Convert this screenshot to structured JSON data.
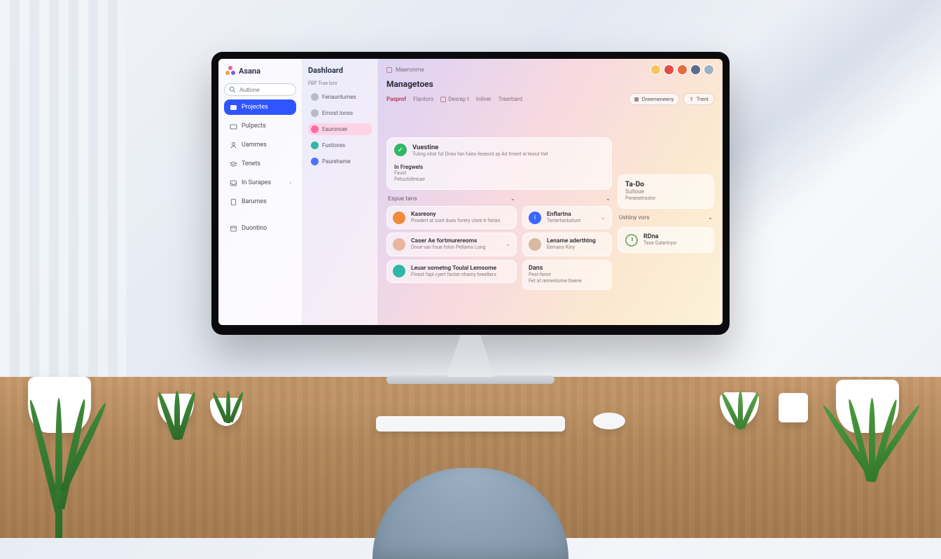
{
  "brand": {
    "name": "Asana"
  },
  "search": {
    "placeholder": "Autlone"
  },
  "sidebar": {
    "items": [
      {
        "label": "Projectes",
        "icon": "home-icon",
        "active": true
      },
      {
        "label": "Pulpects",
        "icon": "folder-icon"
      },
      {
        "label": "Uammes",
        "icon": "user-icon"
      },
      {
        "label": "Tenets",
        "icon": "layers-icon"
      },
      {
        "label": "In Surapes",
        "icon": "inbox-icon",
        "caret": true
      },
      {
        "label": "Barumes",
        "icon": "doc-icon"
      },
      {
        "label": "Duontino",
        "icon": "calendar-icon"
      }
    ]
  },
  "subpanel": {
    "title": "Dashloard",
    "caption": "FBP   True lors",
    "items": [
      {
        "label": "Fenauntumes",
        "dot": "gray"
      },
      {
        "label": "Emost lonss",
        "dot": "gray"
      },
      {
        "label": "Eauronoer",
        "dot": "pink",
        "active": true
      },
      {
        "label": "Fustiores",
        "dot": "teal"
      },
      {
        "label": "Paurehame",
        "dot": "blue"
      }
    ]
  },
  "breadcrumb": {
    "text": "Maeronme"
  },
  "header": {
    "title": "Managetoes",
    "tabs": [
      {
        "label": "Pasprof"
      },
      {
        "label": "Flantors"
      },
      {
        "label": "Desrep t"
      },
      {
        "label": "Inliner"
      },
      {
        "label": "Treerbard"
      }
    ],
    "toolbar": {
      "left": "Dreemeneeny",
      "right": "Trent"
    }
  },
  "overview": {
    "done": {
      "title": "Vuestine",
      "desc": "Tuling nhat fut Dnes fan fules feseord ay Ad tment al tesiul tret"
    },
    "progress": {
      "title": "In Fregwels",
      "sub": "Faust",
      "desc": "Petuctidtntuer"
    }
  },
  "todo": {
    "title": "Ta-Do",
    "sub": "Sultoue",
    "desc": "Penesetrastor"
  },
  "groups": {
    "left": {
      "title": "Espue tans",
      "items": [
        {
          "title": "Kasreony",
          "desc": "Posdert at sont dues forery clare tr ferlan",
          "avatar": "or"
        },
        {
          "title": "Caser  Ae fortmurereoms",
          "desc": "Dnoe van foue folon Pellams Long",
          "avatar": "pk"
        },
        {
          "title": "Leuar sometng Toulal Lemsome",
          "desc": "Flnest fapl cyert fanter nhamy breelters",
          "avatar": "tl"
        }
      ]
    },
    "mid": {
      "items": [
        {
          "title": "Enflartna",
          "desc": "Tertertankatunt",
          "avatar": "bl"
        },
        {
          "title": "Lename aderthtng",
          "desc": "Eemans  Kiny",
          "avatar": "ph"
        },
        {
          "title": "Dans",
          "sub": "Pest-fennr",
          "desc": "Fet at remestome tlaene"
        }
      ]
    }
  },
  "upcoming": {
    "title": "Ushiny vors",
    "item": {
      "title": "RDna",
      "desc": "Tese Gatertrysr"
    }
  }
}
